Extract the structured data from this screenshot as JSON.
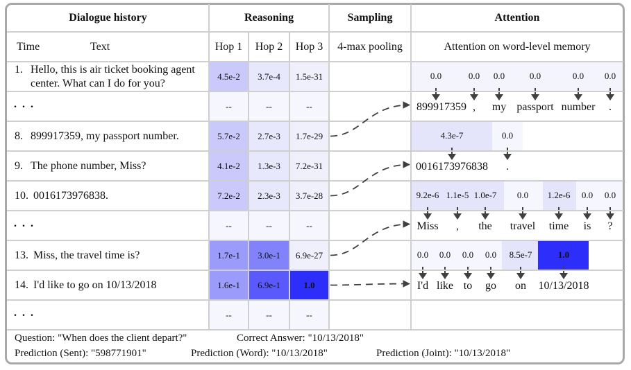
{
  "headers": {
    "dialogue_history": "Dialogue history",
    "reasoning": "Reasoning",
    "sampling": "Sampling",
    "attention": "Attention"
  },
  "subheaders": {
    "time": "Time",
    "text": "Text",
    "hop1": "Hop 1",
    "hop2": "Hop 2",
    "hop3": "Hop 3",
    "pooling": "4-max pooling",
    "attention_desc": "Attention on word-level memory"
  },
  "colors": {
    "grid": "#cfcfcf",
    "frame": "#a9a9a9",
    "arrow": "#404040",
    "heat_scale": [
      "#f6f6fe",
      "#ececfd",
      "#e4e4fb",
      "#c9c9fb",
      "#9b9bfb",
      "#8282fb",
      "#5a5afc",
      "#2e2efb"
    ]
  },
  "rows": [
    {
      "time": "1.",
      "text_lines": [
        "Hello, this is air ticket booking agent",
        "center. What can I do for you?"
      ],
      "hops": [
        {
          "v": "4.5e-2",
          "c": "#c9c9fb"
        },
        {
          "v": "3.7e-4",
          "c": "#e8e8fc"
        },
        {
          "v": "1.5e-31",
          "c": "#f0f0fd"
        }
      ]
    },
    {
      "time": "...",
      "text_lines": [],
      "ellipsis": true,
      "hops": [
        {
          "v": "--",
          "c": "#f6f6fe"
        },
        {
          "v": "--",
          "c": "#f6f6fe"
        },
        {
          "v": "--",
          "c": "#f6f6fe"
        }
      ]
    },
    {
      "time": "8.",
      "text_lines": [
        "899917359, my passport number."
      ],
      "hops": [
        {
          "v": "5.7e-2",
          "c": "#c9c9fb"
        },
        {
          "v": "2.7e-3",
          "c": "#e8e8fc"
        },
        {
          "v": "1.7e-29",
          "c": "#f0f0fd"
        }
      ]
    },
    {
      "time": "9.",
      "text_lines": [
        "The phone number, Miss?"
      ],
      "hops": [
        {
          "v": "4.1e-2",
          "c": "#c9c9fb"
        },
        {
          "v": "1.3e-3",
          "c": "#e8e8fc"
        },
        {
          "v": "7.2e-31",
          "c": "#f0f0fd"
        }
      ]
    },
    {
      "time": "10.",
      "text_lines": [
        "0016173976838."
      ],
      "hops": [
        {
          "v": "7.2e-2",
          "c": "#c9c9fb"
        },
        {
          "v": "2.3e-3",
          "c": "#e8e8fc"
        },
        {
          "v": "3.7e-28",
          "c": "#f0f0fd"
        }
      ]
    },
    {
      "time": "...",
      "text_lines": [],
      "ellipsis": true,
      "hops": [
        {
          "v": "--",
          "c": "#f6f6fe"
        },
        {
          "v": "--",
          "c": "#f6f6fe"
        },
        {
          "v": "--",
          "c": "#f6f6fe"
        }
      ]
    },
    {
      "time": "13.",
      "text_lines": [
        "Miss, the travel time is?"
      ],
      "hops": [
        {
          "v": "1.7e-1",
          "c": "#9b9bfb"
        },
        {
          "v": "3.0e-1",
          "c": "#8282fb"
        },
        {
          "v": "6.9e-27",
          "c": "#f0f0fd"
        }
      ]
    },
    {
      "time": "14.",
      "text_lines": [
        "I'd like to go on 10/13/2018"
      ],
      "hops": [
        {
          "v": "1.6e-1",
          "c": "#9b9bfb"
        },
        {
          "v": "6.9e-1",
          "c": "#5a5afc"
        },
        {
          "v": "1.0",
          "c": "#2e2efb",
          "bold": true
        }
      ]
    },
    {
      "time": "...",
      "text_lines": [],
      "ellipsis": true,
      "hops": [
        {
          "v": "--",
          "c": "#f6f6fe"
        },
        {
          "v": "--",
          "c": "#f6f6fe"
        },
        {
          "v": "--",
          "c": "#f6f6fe"
        }
      ]
    }
  ],
  "attention_groups": [
    {
      "source_row": 2,
      "weights": [
        {
          "v": "0.0",
          "c": "#f4f4fd"
        },
        {
          "v": "0.0",
          "c": "#f4f4fd"
        },
        {
          "v": "0.0",
          "c": "#f4f4fd"
        },
        {
          "v": "0.0",
          "c": "#f4f4fd"
        },
        {
          "v": "0.0",
          "c": "#f4f4fd"
        },
        {
          "v": "0.0",
          "c": "#f4f4fd"
        }
      ],
      "words": [
        "899917359",
        ",",
        "my",
        "passport",
        "number",
        "."
      ]
    },
    {
      "source_row": 4,
      "weights": [
        {
          "v": "4.3e-7",
          "c": "#e4e4fb"
        },
        {
          "v": "0.0",
          "c": "#f6f6fe"
        }
      ],
      "words": [
        "0016173976838",
        "."
      ]
    },
    {
      "source_row": 6,
      "weights": [
        {
          "v": "9.2e-6",
          "c": "#e4e4fb"
        },
        {
          "v": "1.1e-5",
          "c": "#e4e4fb"
        },
        {
          "v": "1.0e-7",
          "c": "#e4e4fb"
        },
        {
          "v": "0.0",
          "c": "#f6f6fe"
        },
        {
          "v": "1.2e-6",
          "c": "#e4e4fb"
        },
        {
          "v": "0.0",
          "c": "#f6f6fe"
        },
        {
          "v": "0.0",
          "c": "#f6f6fe"
        }
      ],
      "words": [
        "Miss",
        ",",
        "the",
        "travel",
        "time",
        "is",
        "?"
      ]
    },
    {
      "source_row": 7,
      "weights": [
        {
          "v": "0.0",
          "c": "#f6f6fe"
        },
        {
          "v": "0.0",
          "c": "#f6f6fe"
        },
        {
          "v": "0.0",
          "c": "#f6f6fe"
        },
        {
          "v": "0.0",
          "c": "#f6f6fe"
        },
        {
          "v": "8.5e-7",
          "c": "#e4e4fb"
        },
        {
          "v": "1.0",
          "c": "#2e2efb",
          "bold": true
        }
      ],
      "words": [
        "I'd",
        "like",
        "to",
        "go",
        "on",
        "10/13/2018"
      ]
    }
  ],
  "footer": {
    "question": "Question: \"When does the client depart?\"",
    "correct_answer": "Correct Answer: \"10/13/2018\"",
    "prediction_sent": "Prediction (Sent): \"598771901\"",
    "prediction_word": "Prediction (Word): \"10/13/2018\"",
    "prediction_joint": "Prediction (Joint): \"10/13/2018\""
  }
}
